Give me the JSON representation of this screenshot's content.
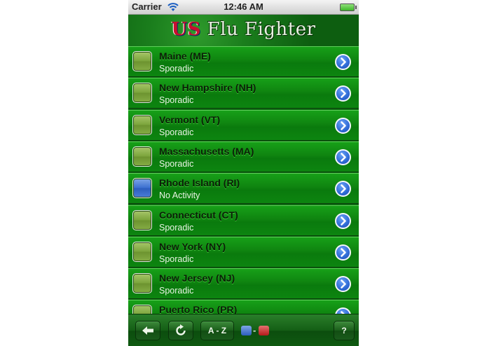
{
  "status_bar": {
    "carrier": "Carrier",
    "time": "12:46 AM",
    "wifi_icon": "wifi-icon",
    "battery_icon": "battery-icon"
  },
  "navbar": {
    "title_prefix": "US",
    "title_suffix": " Flu Fighter"
  },
  "colors": {
    "row_green": "#0f8410",
    "sporadic_green": "#7aa33a",
    "no_activity_blue": "#3b6fd0",
    "detail_blue": "#2e6ad6"
  },
  "states": [
    {
      "name": "Maine (ME)",
      "status": "Sporadic",
      "level": "green"
    },
    {
      "name": "New Hampshire (NH)",
      "status": "Sporadic",
      "level": "green"
    },
    {
      "name": "Vermont (VT)",
      "status": "Sporadic",
      "level": "green"
    },
    {
      "name": "Massachusetts (MA)",
      "status": "Sporadic",
      "level": "green"
    },
    {
      "name": "Rhode Island (RI)",
      "status": "No Activity",
      "level": "blue"
    },
    {
      "name": "Connecticut (CT)",
      "status": "Sporadic",
      "level": "green"
    },
    {
      "name": "New York (NY)",
      "status": "Sporadic",
      "level": "green"
    },
    {
      "name": "New Jersey (NJ)",
      "status": "Sporadic",
      "level": "green"
    },
    {
      "name": "Puerto Rico (PR)",
      "status": "",
      "level": "green"
    }
  ],
  "toolbar": {
    "back_icon": "arrow-left-icon",
    "refresh_icon": "refresh-icon",
    "sort_label": "A - Z",
    "legend_separator": "-",
    "help_label": "?"
  }
}
